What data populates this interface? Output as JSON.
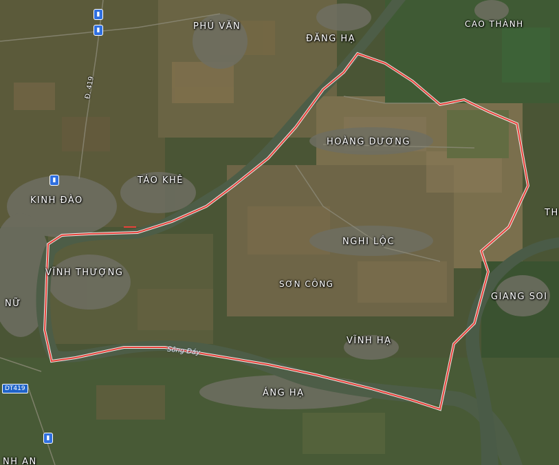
{
  "places": [
    "PHÚ VĂN",
    "ĐĂNG HẠ",
    "CAO THÀNH",
    "HOÀNG DƯƠNG",
    "TÁO KHÊ",
    "KINH ĐÀO",
    "NGHI LỘC",
    "VĨNH THƯỢNG",
    "SƠN CÔNG",
    "GIANG SOI",
    "NỮ",
    "VĨNH HẠ",
    "ÁNG HẠ",
    "TH",
    "NH AN"
  ],
  "river_label": "Sông Đáy",
  "road_label": "Đ. 419",
  "road_shield": "DT419",
  "icons": [
    "bus-stop-icon"
  ],
  "colors": {
    "boundary": "#e8413a",
    "bus_stop": "#2f6fe0"
  }
}
